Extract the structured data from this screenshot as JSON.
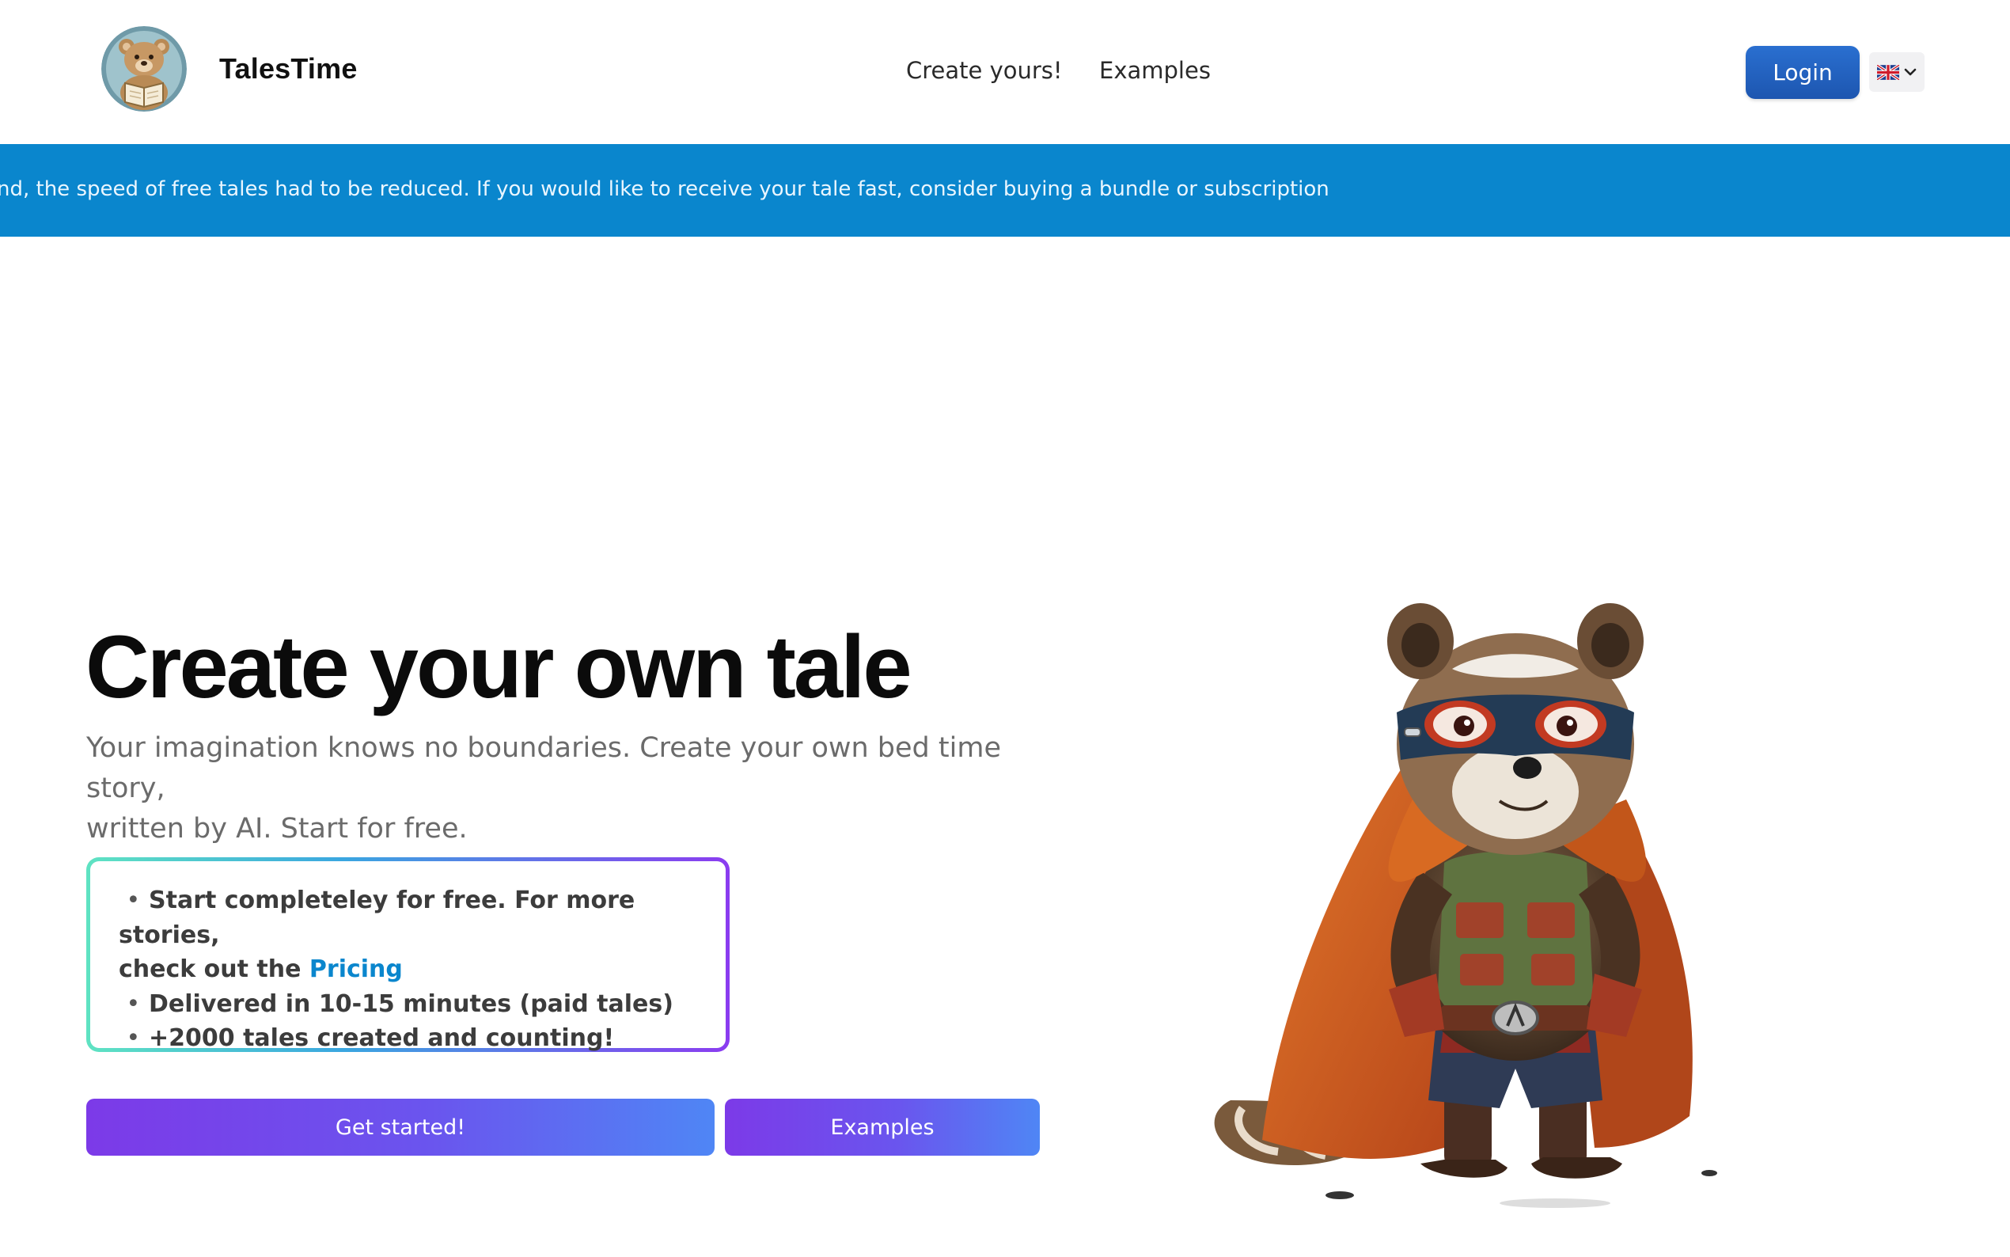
{
  "header": {
    "brand_name": "TalesTime",
    "nav": {
      "create": "Create yours!",
      "examples": "Examples"
    },
    "login_label": "Login",
    "language": {
      "selected": "en-GB",
      "flag_icon": "uk-flag-icon"
    }
  },
  "banner": {
    "text": "nd, the speed of free tales had to be reduced. If you would like to receive your tale fast, consider buying a bundle or subscription"
  },
  "hero": {
    "title": "Create your own tale",
    "subtitle_line1": "Your imagination knows no boundaries. Create your own bed time story,",
    "subtitle_line2": "written by AI. Start for free.",
    "features": [
      {
        "text": "Start completeley for free. For more stories,",
        "continuation": "check out the ",
        "link": "Pricing"
      },
      {
        "text": "Delivered in 10-15 minutes (paid tales)"
      },
      {
        "text": "+2000 tales created and counting!"
      }
    ],
    "cta_primary": "Get started!",
    "cta_secondary": "Examples"
  },
  "colors": {
    "banner_bg": "#0a86cd",
    "login_bg": "#1d56b0",
    "link": "#0a86cd",
    "cta_start": "#7c3ae8",
    "cta_end": "#4f86f5"
  }
}
